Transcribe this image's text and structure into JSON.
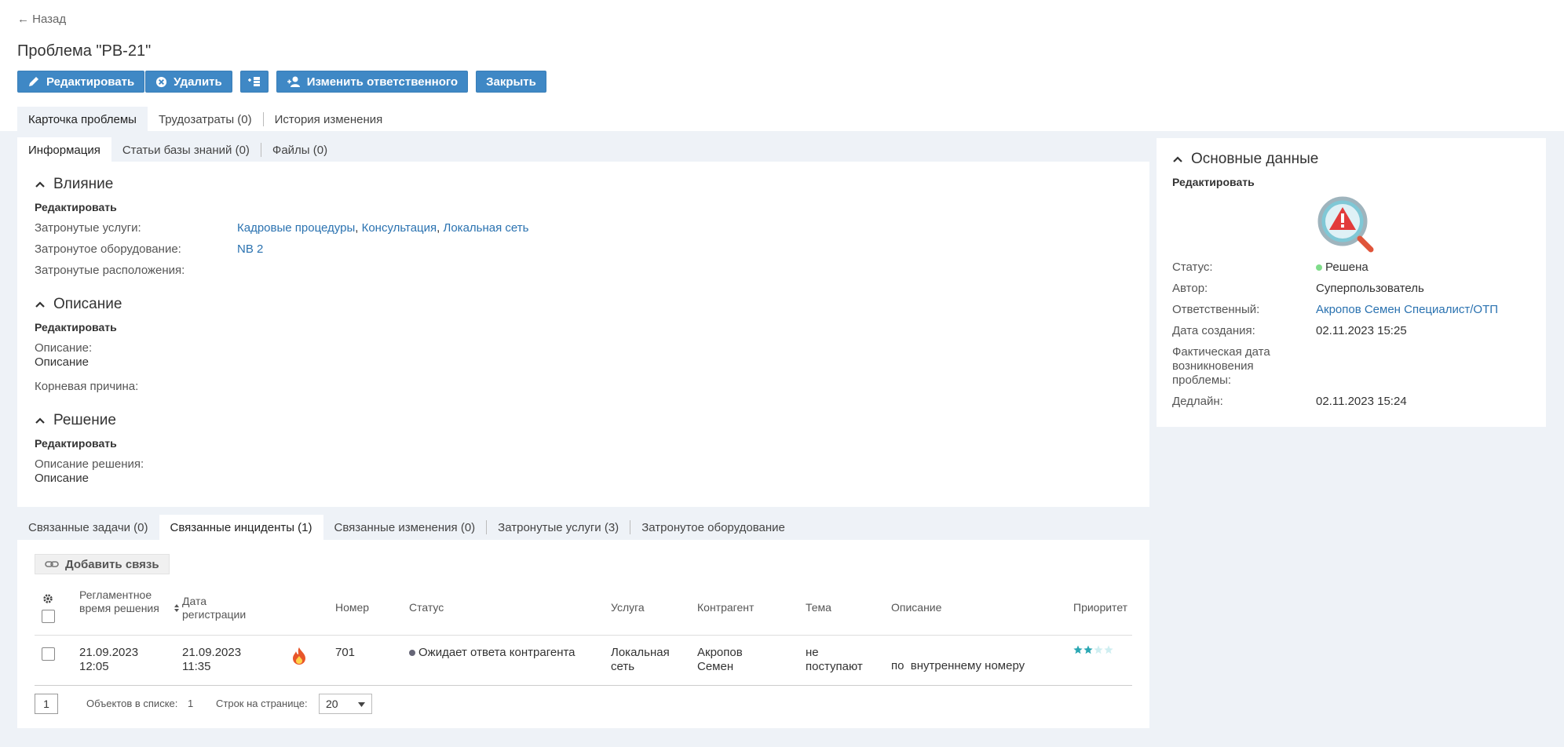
{
  "header": {
    "back_label": "← Назад",
    "title": "Проблема \"PB-21\"",
    "toolbar": {
      "edit": "Редактировать",
      "delete": "Удалить",
      "change_owner": "Изменить ответственного",
      "close": "Закрыть"
    },
    "tabs": [
      "Карточка проблемы",
      "Трудозатраты (0)",
      "История изменения"
    ]
  },
  "info": {
    "tabs": [
      "Информация",
      "Статьи базы знаний (0)",
      "Файлы (0)"
    ],
    "impact": {
      "title": "Влияние",
      "edit": "Редактировать",
      "services_label": "Затронутые услуги:",
      "services": [
        "Кадровые процедуры",
        "Консультация",
        "Локальная сеть"
      ],
      "equipment_label": "Затронутое оборудование:",
      "equipment": "NB 2",
      "locations_label": "Затронутые расположения:"
    },
    "description": {
      "title": "Описание",
      "edit": "Редактировать",
      "desc_label": "Описание:",
      "desc_value": "Описание",
      "root_cause_label": "Корневая причина:"
    },
    "solution": {
      "title": "Решение",
      "edit": "Редактировать",
      "desc_label": "Описание решения:",
      "desc_value": "Описание"
    }
  },
  "main_data": {
    "title": "Основные данные",
    "edit": "Редактировать",
    "status_label": "Статус:",
    "status_value": "Решена",
    "status_color": "#7fdc8a",
    "author_label": "Автор:",
    "author_value": "Суперпользователь",
    "owner_label": "Ответственный:",
    "owner_value": "Акропов Семен Специалист/ОТП",
    "created_label": "Дата создания:",
    "created_value": "02.11.2023 15:25",
    "actual_label": "Фактическая дата возникновения проблемы:",
    "deadline_label": "Дедлайн:",
    "deadline_value": "02.11.2023 15:24"
  },
  "related": {
    "tabs": [
      "Связанные задачи (0)",
      "Связанные инциденты (1)",
      "Связанные изменения (0)",
      "Затронутые услуги (3)",
      "Затронутое оборудование"
    ],
    "add_link": "Добавить связь",
    "columns": {
      "reg_time": "Регламентное время решения",
      "reg_date": "Дата регистрации",
      "number": "Номер",
      "status": "Статус",
      "service": "Услуга",
      "contractor": "Контрагент",
      "topic": "Тема",
      "description": "Описание",
      "priority": "Приоритет"
    },
    "rows": [
      {
        "reg_time": "21.09.2023 12:05",
        "reg_date": "21.09.2023 11:35",
        "number": "701",
        "status": "Ожидает ответа контрагента",
        "status_color": "#666677",
        "service": "Локальная сеть",
        "contractor": "Акропов Семен",
        "topic": "не поступают",
        "description": "по  внутреннему номеру",
        "priority": 2
      }
    ],
    "pager": {
      "page": "1",
      "count_label": "Объектов в списке:",
      "count_value": "1",
      "per_page_label": "Строк на странице:",
      "per_page_value": "20"
    }
  }
}
